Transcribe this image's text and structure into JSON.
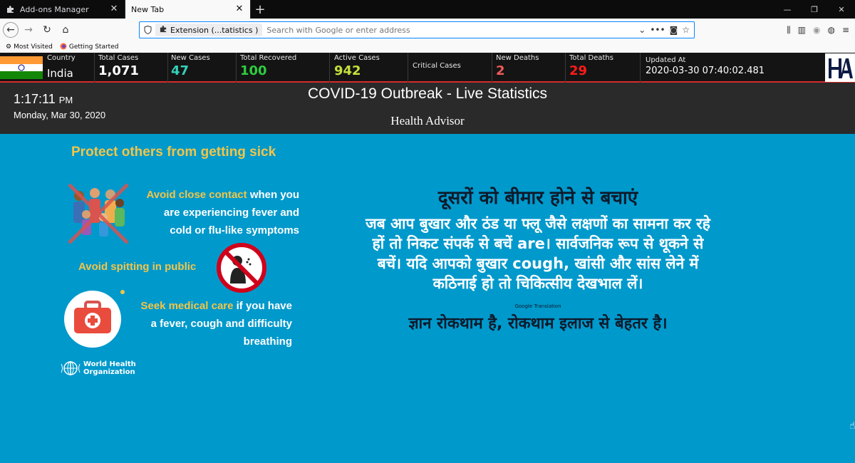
{
  "browser": {
    "tabs": [
      {
        "label": "Add-ons Manager",
        "icon": "puzzle-icon",
        "active": false
      },
      {
        "label": "New Tab",
        "icon": "",
        "active": true
      }
    ],
    "url_extension_label": "Extension (...tatistics )",
    "url_placeholder": "Search with Google or enter address",
    "bookmarks": [
      {
        "label": "Most Visited",
        "icon": "gear-icon"
      },
      {
        "label": "Getting Started",
        "icon": "firefox-icon"
      }
    ]
  },
  "stats": {
    "country_label": "Country",
    "country_value": "India",
    "total_cases_label": "Total Cases",
    "total_cases_value": "1,071",
    "new_cases_label": "New Cases",
    "new_cases_value": "47",
    "total_recovered_label": "Total Recovered",
    "total_recovered_value": "100",
    "active_cases_label": "Active Cases",
    "active_cases_value": "942",
    "critical_cases_label": "Critical Cases",
    "new_deaths_label": "New Deaths",
    "new_deaths_value": "2",
    "total_deaths_label": "Total Deaths",
    "total_deaths_value": "29",
    "updated_label": "Updated At",
    "updated_value": "2020-03-30 07:40:02.481",
    "colors": {
      "new_cases": "#33d1b8",
      "recovered": "#2ecc40",
      "active": "#c6e03a",
      "new_deaths": "#f05a5a",
      "total_deaths": "#ff1a1a"
    }
  },
  "header": {
    "time": "1:17:11",
    "ampm": "PM",
    "date": "Monday, Mar 30, 2020",
    "title": "COVID-19 Outbreak - Live Statistics",
    "subtitle": "Health Advisor"
  },
  "infographic": {
    "title": "Protect others from getting sick",
    "item1_highlight": "Avoid close contact",
    "item1_rest_a": " when you",
    "item1_rest_b": "are experiencing fever and",
    "item1_rest_c": "cold or flu-like symptoms",
    "item2": "Avoid spitting in public",
    "item3_highlight": "Seek medical care",
    "item3_rest_a": " if you have",
    "item3_rest_b": "a fever, cough and difficulty",
    "item3_rest_c": "breathing",
    "who_line1": "World Health",
    "who_line2": "Organization"
  },
  "hindi": {
    "title": "दूसरों को बीमार होने से बचाएं",
    "line1": "जब आप बुखार और ठंड या फ्लू जैसे लक्षणों का सामना कर रहे",
    "line2": "हों तो निकट संपर्क से बचें are। सार्वजनिक रूप से थूकने से",
    "line3": "बचें। यदि आपको बुखार cough, खांसी और सांस लेने में",
    "line4": "कठिनाई हो तो चिकित्सीय देखभाल लें।",
    "google_translation": "Google Translation",
    "footer": "ज्ञान रोकथाम है, रोकथाम इलाज से बेहतर है।"
  }
}
